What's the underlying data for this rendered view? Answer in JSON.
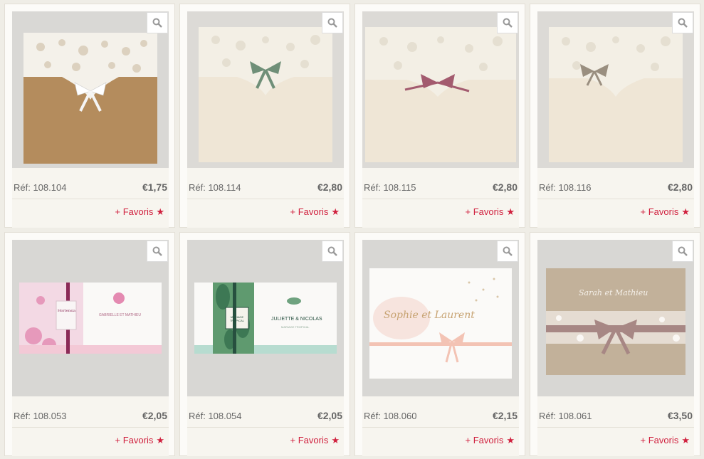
{
  "products": [
    {
      "ref": "Réf: 108.104",
      "price": "€1,75",
      "fav_label": "+ Favoris",
      "image_alt": "kraft-lace-envelope",
      "ribbon_color": "#ffffff"
    },
    {
      "ref": "Réf: 108.114",
      "price": "€2,80",
      "fav_label": "+ Favoris",
      "image_alt": "ivory-lace-envelope-green-bow",
      "ribbon_color": "#6f8f78"
    },
    {
      "ref": "Réf: 108.115",
      "price": "€2,80",
      "fav_label": "+ Favoris",
      "image_alt": "ivory-lace-envelope-mauve-bow",
      "ribbon_color": "#a35b6f"
    },
    {
      "ref": "Réf: 108.116",
      "price": "€2,80",
      "fav_label": "+ Favoris",
      "image_alt": "ivory-lace-envelope-taupe-bow",
      "ribbon_color": "#9a8f80"
    },
    {
      "ref": "Réf: 108.053",
      "price": "€2,05",
      "fav_label": "+ Favoris",
      "image_alt": "floral-pink-card",
      "ribbon_color": "#8b2a57",
      "card_text": [
        "Hortensia",
        "GABRIELLE ET MATHIEU"
      ]
    },
    {
      "ref": "Réf: 108.054",
      "price": "€2,05",
      "fav_label": "+ Favoris",
      "image_alt": "tropical-leaf-card",
      "ribbon_color": "#27503f",
      "card_text": [
        "MARIAGE TROPICAL",
        "JULIETTE & NICOLAS",
        "MARIAGE TROPICAL"
      ]
    },
    {
      "ref": "Réf: 108.060",
      "price": "€2,15",
      "fav_label": "+ Favoris",
      "image_alt": "white-card-peach-bow",
      "ribbon_color": "#f3c3b4",
      "card_text": [
        "Sophie et Laurent"
      ]
    },
    {
      "ref": "Réf: 108.061",
      "price": "€3,50",
      "fav_label": "+ Favoris",
      "image_alt": "taupe-lace-card",
      "ribbon_color": "#a78784",
      "card_text": [
        "Sarah et Mathieu"
      ]
    }
  ],
  "icons": {
    "zoom": "magnifier-icon",
    "favorite": "star-icon"
  },
  "colors": {
    "accent": "#d0203e",
    "background": "#efede6"
  }
}
